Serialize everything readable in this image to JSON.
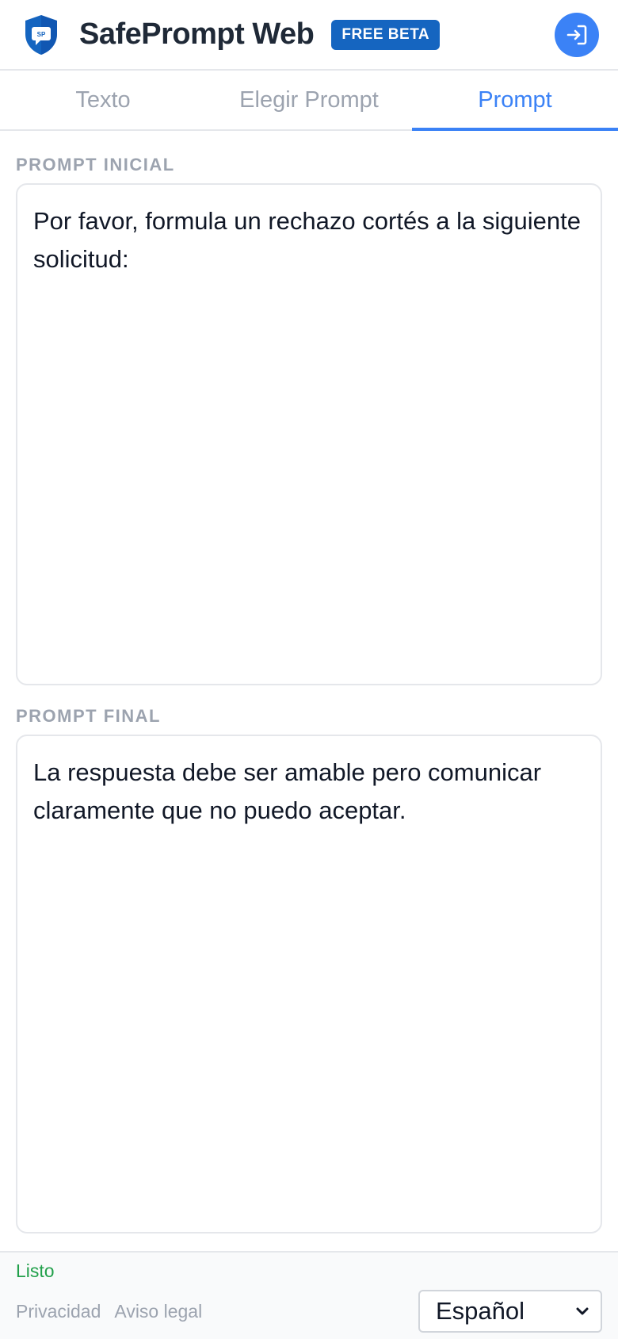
{
  "header": {
    "logo_text": "SP",
    "brand": "SafePrompt Web",
    "badge": "FREE BETA"
  },
  "tabs": [
    {
      "label": "Texto",
      "active": false
    },
    {
      "label": "Elegir Prompt",
      "active": false
    },
    {
      "label": "Prompt",
      "active": true
    }
  ],
  "prompt_initial": {
    "label": "PROMPT INICIAL",
    "value": "Por favor, formula un rechazo cortés a la siguiente solicitud:"
  },
  "prompt_final": {
    "label": "PROMPT FINAL",
    "value": "La respuesta debe ser amable pero comunicar claramente que no puedo aceptar."
  },
  "footer": {
    "status": "Listo",
    "links": [
      "Privacidad",
      "Aviso legal"
    ],
    "language": "Español"
  },
  "colors": {
    "accent": "#3b82f6",
    "badge": "#1565c0",
    "status_ok": "#22a04b",
    "muted": "#9ca3af"
  },
  "icons": {
    "logo": "shield-chat-icon",
    "login": "sign-in-icon",
    "select": "chevron-down-icon"
  }
}
